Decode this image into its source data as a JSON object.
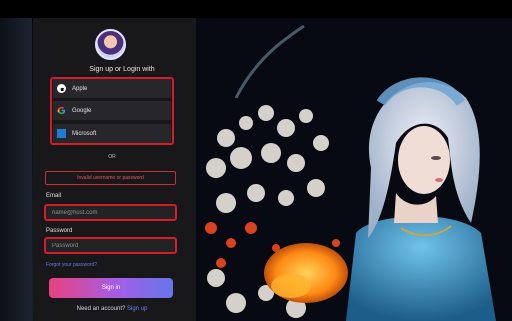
{
  "login": {
    "title": "Sign up or Login with",
    "providers": [
      {
        "label": "Apple",
        "icon": "apple-icon"
      },
      {
        "label": "Google",
        "icon": "google-icon"
      },
      {
        "label": "Microsoft",
        "icon": "microsoft-icon"
      }
    ],
    "or_label": "OR",
    "error": "Invalid username or password",
    "email": {
      "label": "Email",
      "placeholder": "name@host.com",
      "value": ""
    },
    "password": {
      "label": "Password",
      "placeholder": "Password",
      "value": ""
    },
    "forgot_link": "Forgot your password?",
    "submit_label": "Sign in",
    "signup_prompt": "Need an account?",
    "signup_link": "Sign up"
  },
  "colors": {
    "error_outline": "#d31c2c",
    "link": "#6d86f3",
    "button_gradient": [
      "#e8427b",
      "#a35ee6",
      "#6676ea"
    ]
  }
}
